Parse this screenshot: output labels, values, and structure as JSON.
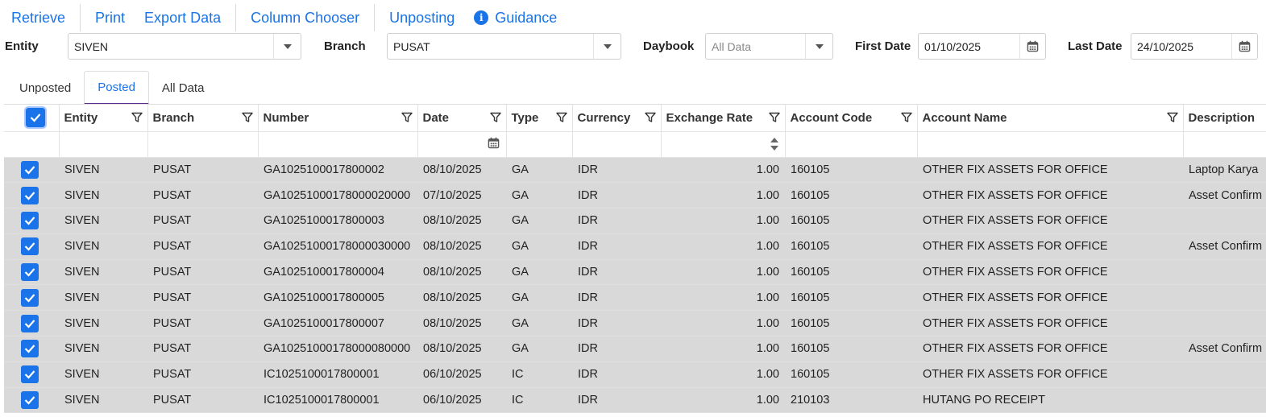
{
  "toolbar": {
    "retrieve": "Retrieve",
    "print": "Print",
    "export": "Export Data",
    "column_chooser": "Column Chooser",
    "unposting": "Unposting",
    "guidance": "Guidance",
    "guidance_icon": "info-icon"
  },
  "filters": {
    "entity_label": "Entity",
    "entity_value": "SIVEN",
    "branch_label": "Branch",
    "branch_value": "PUSAT",
    "daybook_label": "Daybook",
    "daybook_placeholder": "All Data",
    "first_date_label": "First Date",
    "first_date_value": "01/10/2025",
    "last_date_label": "Last Date",
    "last_date_value": "24/10/2025"
  },
  "tabs": [
    {
      "label": "Unposted"
    },
    {
      "label": "Posted",
      "active": true
    },
    {
      "label": "All Data"
    }
  ],
  "grid": {
    "columns": [
      "Entity",
      "Branch",
      "Number",
      "Date",
      "Type",
      "Currency",
      "Exchange Rate",
      "Account Code",
      "Account Name",
      "Description"
    ],
    "rows": [
      {
        "entity": "SIVEN",
        "branch": "PUSAT",
        "number": "GA1025100017800002",
        "date": "08/10/2025",
        "type": "GA",
        "currency": "IDR",
        "rate": "1.00",
        "account_code": "160105",
        "account_name": "OTHER FIX ASSETS FOR OFFICE",
        "description": "Laptop Karya"
      },
      {
        "entity": "SIVEN",
        "branch": "PUSAT",
        "number": "GA10251000178000020000",
        "date": "07/10/2025",
        "type": "GA",
        "currency": "IDR",
        "rate": "1.00",
        "account_code": "160105",
        "account_name": "OTHER FIX ASSETS FOR OFFICE",
        "description": "Asset Confirm"
      },
      {
        "entity": "SIVEN",
        "branch": "PUSAT",
        "number": "GA1025100017800003",
        "date": "08/10/2025",
        "type": "GA",
        "currency": "IDR",
        "rate": "1.00",
        "account_code": "160105",
        "account_name": "OTHER FIX ASSETS FOR OFFICE",
        "description": ""
      },
      {
        "entity": "SIVEN",
        "branch": "PUSAT",
        "number": "GA10251000178000030000",
        "date": "08/10/2025",
        "type": "GA",
        "currency": "IDR",
        "rate": "1.00",
        "account_code": "160105",
        "account_name": "OTHER FIX ASSETS FOR OFFICE",
        "description": "Asset Confirm"
      },
      {
        "entity": "SIVEN",
        "branch": "PUSAT",
        "number": "GA1025100017800004",
        "date": "08/10/2025",
        "type": "GA",
        "currency": "IDR",
        "rate": "1.00",
        "account_code": "160105",
        "account_name": "OTHER FIX ASSETS FOR OFFICE",
        "description": ""
      },
      {
        "entity": "SIVEN",
        "branch": "PUSAT",
        "number": "GA1025100017800005",
        "date": "08/10/2025",
        "type": "GA",
        "currency": "IDR",
        "rate": "1.00",
        "account_code": "160105",
        "account_name": "OTHER FIX ASSETS FOR OFFICE",
        "description": ""
      },
      {
        "entity": "SIVEN",
        "branch": "PUSAT",
        "number": "GA1025100017800007",
        "date": "08/10/2025",
        "type": "GA",
        "currency": "IDR",
        "rate": "1.00",
        "account_code": "160105",
        "account_name": "OTHER FIX ASSETS FOR OFFICE",
        "description": ""
      },
      {
        "entity": "SIVEN",
        "branch": "PUSAT",
        "number": "GA10251000178000080000",
        "date": "08/10/2025",
        "type": "GA",
        "currency": "IDR",
        "rate": "1.00",
        "account_code": "160105",
        "account_name": "OTHER FIX ASSETS FOR OFFICE",
        "description": "Asset Confirm"
      },
      {
        "entity": "SIVEN",
        "branch": "PUSAT",
        "number": "IC1025100017800001",
        "date": "06/10/2025",
        "type": "IC",
        "currency": "IDR",
        "rate": "1.00",
        "account_code": "160105",
        "account_name": "OTHER FIX ASSETS FOR OFFICE",
        "description": ""
      },
      {
        "entity": "SIVEN",
        "branch": "PUSAT",
        "number": "IC1025100017800001",
        "date": "06/10/2025",
        "type": "IC",
        "currency": "IDR",
        "rate": "1.00",
        "account_code": "210103",
        "account_name": "HUTANG PO RECEIPT",
        "description": ""
      }
    ]
  },
  "colors": {
    "accent": "#1a73e8",
    "tab_underline": "#5b2d8e",
    "row_selected_bg": "#d9d9d9"
  }
}
